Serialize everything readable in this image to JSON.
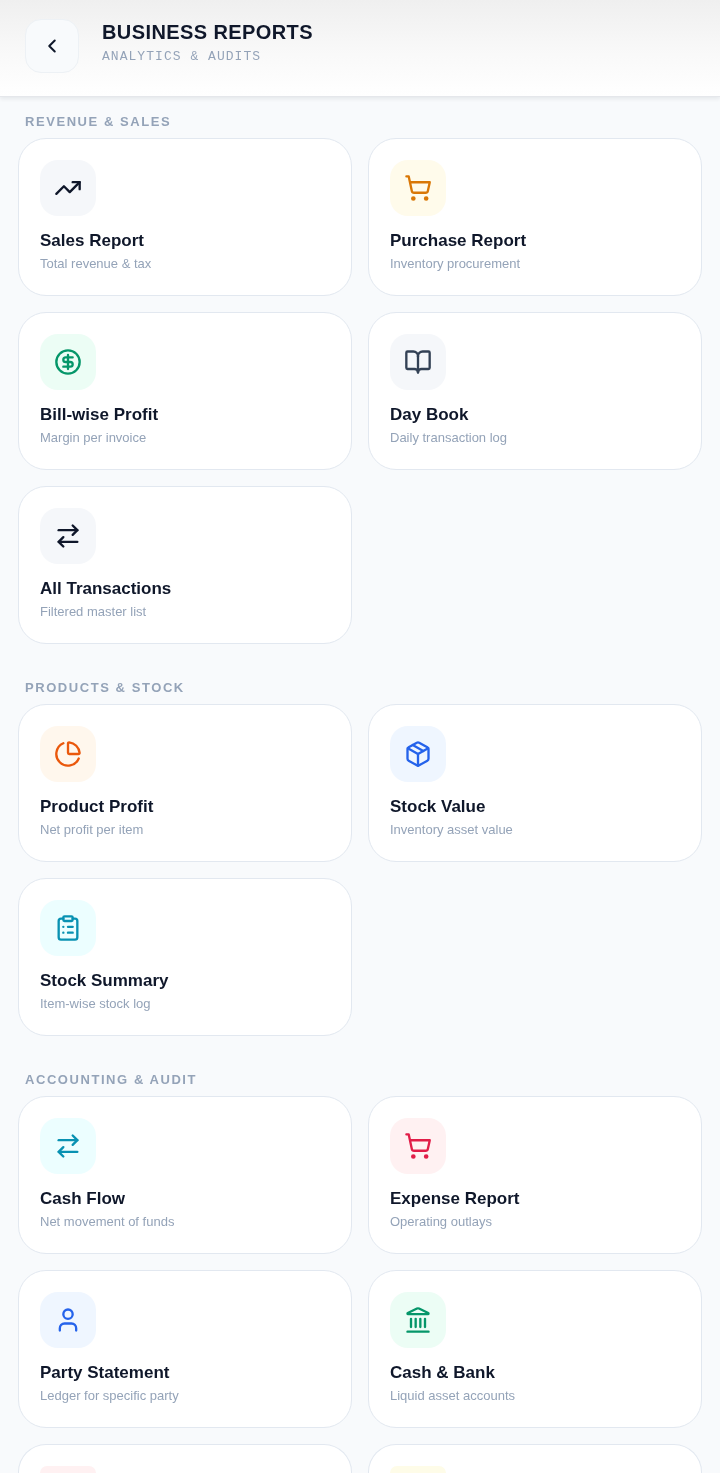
{
  "header": {
    "title": "BUSINESS REPORTS",
    "subtitle": "ANALYTICS & AUDITS"
  },
  "sections": [
    {
      "label": "REVENUE & SALES",
      "items": [
        {
          "title": "Sales Report",
          "subtitle": "Total revenue & tax",
          "tile": {
            "color": "#f5f7fa",
            "icon": {
              "color": "#0f172a"
            }
          }
        },
        {
          "title": "Purchase Report",
          "subtitle": "Inventory procurement",
          "tile": {
            "color": "#fffbeb",
            "icon": {
              "color": "#d97706"
            }
          }
        },
        {
          "title": "Bill-wise Profit",
          "subtitle": "Margin per invoice",
          "tile": {
            "color": "#ecfdf5",
            "icon": {
              "color": "#059669"
            }
          }
        },
        {
          "title": "Day Book",
          "subtitle": "Daily transaction log",
          "tile": {
            "color": "#f5f7fa",
            "icon": {
              "color": "#334155"
            }
          }
        },
        {
          "title": "All Transactions",
          "subtitle": "Filtered master list",
          "tile": {
            "color": "#f5f7fa",
            "icon": {
              "color": "#0f172a"
            }
          }
        }
      ]
    },
    {
      "label": "PRODUCTS & STOCK",
      "items": [
        {
          "title": "Product Profit",
          "subtitle": "Net profit per item",
          "tile": {
            "color": "#fff7ed",
            "icon": {
              "color": "#ea580c"
            }
          }
        },
        {
          "title": "Stock Value",
          "subtitle": "Inventory asset value",
          "tile": {
            "color": "#eff6ff",
            "icon": {
              "color": "#2563eb"
            }
          }
        },
        {
          "title": "Stock Summary",
          "subtitle": "Item-wise stock log",
          "tile": {
            "color": "#ecfeff",
            "icon": {
              "color": "#0891b2"
            }
          }
        }
      ]
    },
    {
      "label": "ACCOUNTING & AUDIT",
      "items": [
        {
          "title": "Cash Flow",
          "subtitle": "Net movement of funds",
          "tile": {
            "color": "#ecfeff",
            "icon": {
              "color": "#0891b2"
            }
          }
        },
        {
          "title": "Expense Report",
          "subtitle": "Operating outlays",
          "tile": {
            "color": "#fff1f2",
            "icon": {
              "color": "#e11d48"
            }
          }
        },
        {
          "title": "Party Statement",
          "subtitle": "Ledger for specific party",
          "tile": {
            "color": "#eff6ff",
            "icon": {
              "color": "#2563eb"
            }
          }
        },
        {
          "title": "Cash & Bank",
          "subtitle": "Liquid asset accounts",
          "tile": {
            "color": "#ecfdf5",
            "icon": {
              "color": "#059669"
            }
          }
        },
        {
          "tile": {
            "color": "#fff1f2"
          }
        },
        {
          "tile": {
            "color": "#fefce8"
          }
        }
      ]
    }
  ]
}
